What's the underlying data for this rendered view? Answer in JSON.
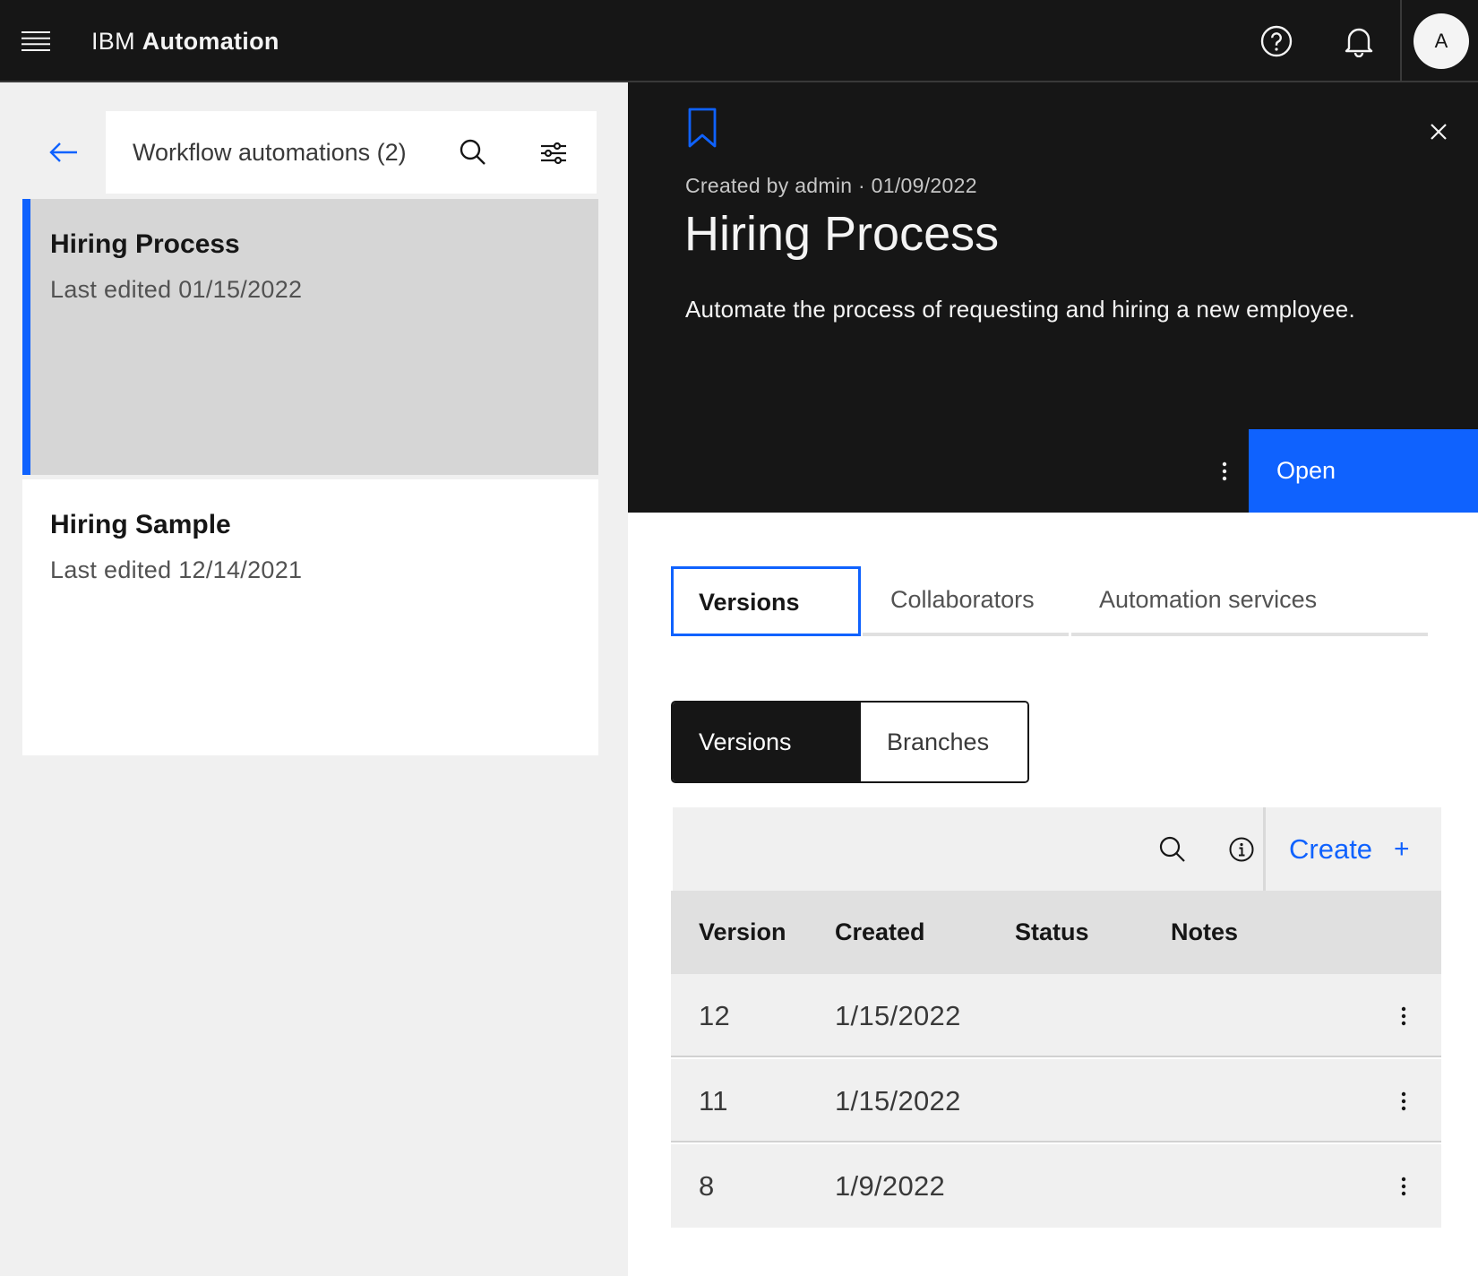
{
  "header": {
    "brand_prefix": "IBM",
    "brand_name": "Automation",
    "avatar_initial": "A",
    "icons": [
      "menu-icon",
      "help-icon",
      "notification-icon"
    ]
  },
  "list_panel": {
    "title": "Workflow automations (2)",
    "items": [
      {
        "name": "Hiring Process",
        "last_edited": "Last edited 01/15/2022",
        "selected": true
      },
      {
        "name": "Hiring Sample",
        "last_edited": "Last edited 12/14/2021",
        "selected": false
      }
    ]
  },
  "detail": {
    "meta": "Created by admin · 01/09/2022",
    "title": "Hiring Process",
    "description": "Automate the process of requesting and hiring a new employee.",
    "open_label": "Open",
    "tabs": [
      {
        "label": "Versions",
        "active": true
      },
      {
        "label": "Collaborators",
        "active": false
      },
      {
        "label": "Automation services",
        "active": false
      }
    ],
    "switcher": [
      {
        "label": "Versions",
        "selected": true
      },
      {
        "label": "Branches",
        "selected": false
      }
    ],
    "table": {
      "create_label": "Create",
      "create_icon": "+",
      "columns": [
        "Version",
        "Created",
        "Status",
        "Notes"
      ],
      "rows": [
        {
          "version": "12",
          "created": "1/15/2022",
          "status": "",
          "notes": ""
        },
        {
          "version": "11",
          "created": "1/15/2022",
          "status": "",
          "notes": ""
        },
        {
          "version": "8",
          "created": "1/9/2022",
          "status": "",
          "notes": ""
        }
      ]
    }
  },
  "colors": {
    "accent": "#0f62fe",
    "header_bg": "#161616",
    "selected_card": "#d6d6d6",
    "panel_bg": "#f0f0f0"
  }
}
